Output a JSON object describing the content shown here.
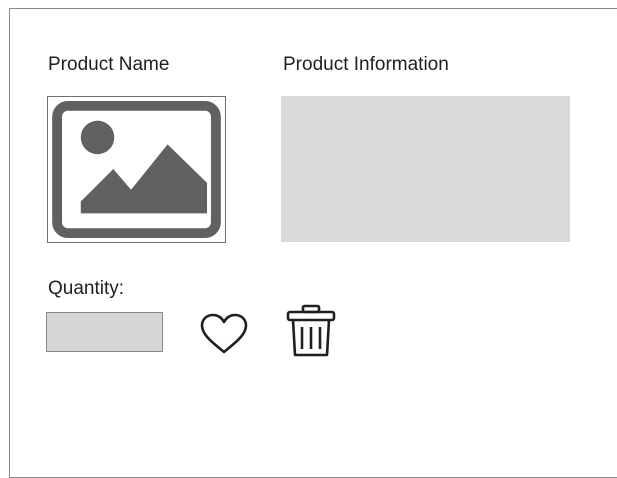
{
  "product": {
    "name_label": "Product Name",
    "info_label": "Product Information",
    "image_icon": "image-placeholder-icon"
  },
  "quantity": {
    "label": "Quantity:",
    "value": ""
  },
  "actions": {
    "favorite_icon": "heart-icon",
    "delete_icon": "trash-icon"
  },
  "colors": {
    "placeholder_gray": "#d9d9d9",
    "icon_dark": "#5f5f5f",
    "border": "#8a8a8a"
  }
}
